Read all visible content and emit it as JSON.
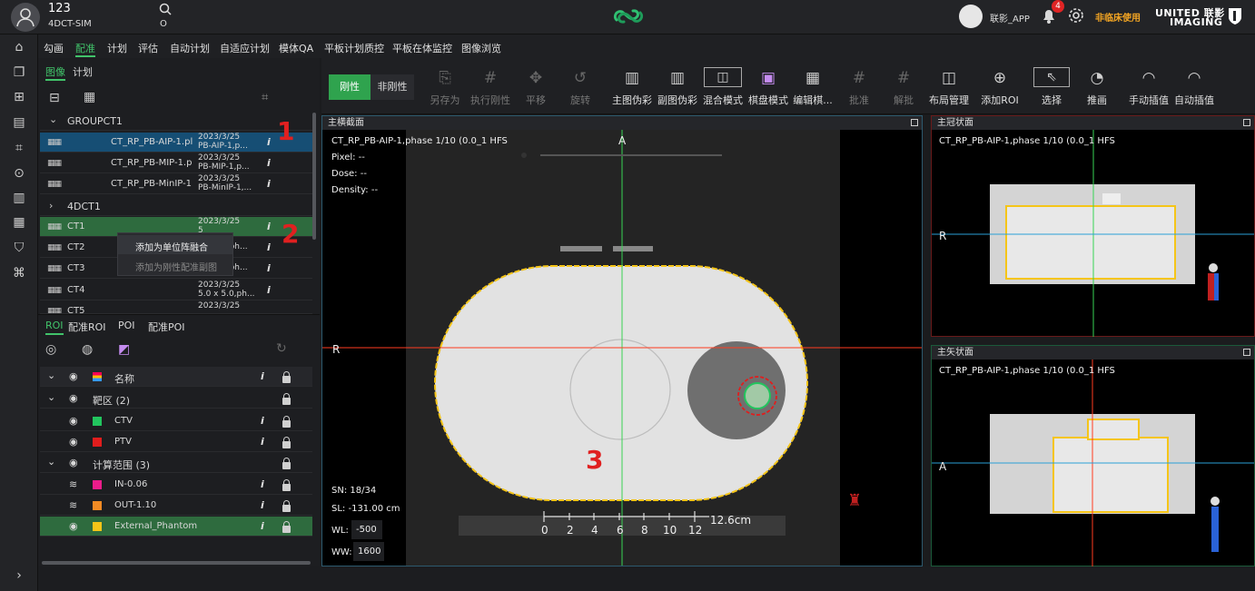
{
  "header": {
    "user_id": "123",
    "user_sub": "4DCT-SIM",
    "search_value": "O",
    "user_name": "联影_APP",
    "notif_count": "4",
    "clinical_note": "非临床使用",
    "brand_en": "UNITED 联影",
    "brand_en2": "IMAGING",
    "accent": "#41c36a",
    "warning": "#f5a623"
  },
  "menu": {
    "items": [
      "勾画",
      "配准",
      "计划",
      "评估",
      "自动计划",
      "自适应计划",
      "模体QA",
      "平板计划质控",
      "平板在体监控",
      "图像浏览"
    ],
    "active": "配准"
  },
  "left": {
    "tab_image": "图像",
    "tab_plan": "计划",
    "group1": "GROUPCT1",
    "rows1": [
      {
        "name": "CT_RP_PB-AIP-1.pl",
        "date": "2023/3/25",
        "desc": "PB-AIP-1,p..."
      },
      {
        "name": "CT_RP_PB-MIP-1.p",
        "date": "2023/3/25",
        "desc": "PB-MIP-1,p..."
      },
      {
        "name": "CT_RP_PB-MinIP-1",
        "date": "2023/3/25",
        "desc": "PB-MinIP-1,..."
      }
    ],
    "group2": "4DCT1",
    "rows2": [
      {
        "name": "CT1",
        "date": "2023/3/25",
        "desc": "5"
      },
      {
        "name": "CT2",
        "date": "",
        "desc": "5 ph..."
      },
      {
        "name": "CT3",
        "date": "",
        "desc": "5 ph..."
      },
      {
        "name": "CT4",
        "date": "2023/3/25",
        "desc": "5.0 x 5.0,ph..."
      },
      {
        "name": "CT5",
        "date": "2023/3/25",
        "desc": ""
      }
    ],
    "context_menu": [
      "添加为单位阵融合",
      "添加为刚性配准副图"
    ],
    "roi_tabs": [
      "ROI",
      "配准ROI",
      "POI",
      "配准POI"
    ],
    "roi_header": "名称",
    "roi_group1": "靶区 (2)",
    "roi_group2": "计算范围 (3)",
    "rois": [
      {
        "name": "CTV",
        "color": "#22c55e"
      },
      {
        "name": "PTV",
        "color": "#e11d1d"
      },
      {
        "name": "IN-0.06",
        "color": "#ec1c8a"
      },
      {
        "name": "OUT-1.10",
        "color": "#f08a24"
      },
      {
        "name": "External_Phantom",
        "color": "#f5c518"
      }
    ]
  },
  "toolbar": {
    "rigid": "刚性",
    "nonrigid": "非刚性",
    "tools": [
      "另存为",
      "执行刚性",
      "平移",
      "旋转",
      "主图伪彩",
      "副图伪彩",
      "混合模式",
      "棋盘模式",
      "编辑棋...",
      "批准",
      "解批",
      "布局管理",
      "添加ROI",
      "选择",
      "推画",
      "手动插值",
      "自动插值"
    ]
  },
  "views": {
    "axial_title": "主横截面",
    "coronal_title": "主冠状面",
    "sagittal_title": "主矢状面",
    "series": "CT_RP_PB-AIP-1,phase 1/10 (0.0_1 HFS",
    "pixel": "Pixel:  --",
    "dose": "Dose:  --",
    "density": "Density:  --",
    "sn": "SN: 18/34",
    "sl": "SL:  -131.00 cm",
    "wl_label": "WL:",
    "wl": "-500",
    "ww_label": "WW:",
    "ww": "1600",
    "orient_a": "A",
    "orient_r": "R",
    "scale": [
      "0",
      "2",
      "4",
      "6",
      "8",
      "10",
      "12"
    ],
    "scale_end": "12.6cm"
  },
  "annotations": [
    "1",
    "2",
    "3"
  ]
}
